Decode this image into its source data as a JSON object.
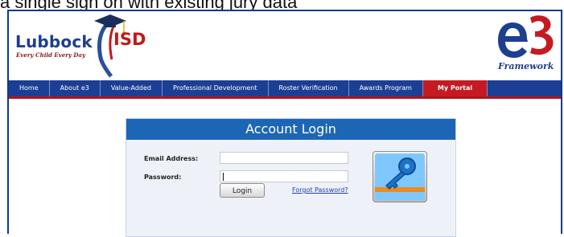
{
  "top_caption": "a single sign on with existing jury data",
  "logo": {
    "name": "Lubbock",
    "suffix": "ISD",
    "tagline": "Every Child Every Day"
  },
  "brand": {
    "framework": "Framework"
  },
  "nav": [
    {
      "label": "Home",
      "active": false
    },
    {
      "label": "About e3",
      "active": false
    },
    {
      "label": "Value-Added",
      "active": false
    },
    {
      "label": "Professional Development",
      "active": false
    },
    {
      "label": "Roster Verification",
      "active": false
    },
    {
      "label": "Awards Program",
      "active": false
    },
    {
      "label": "My Portal",
      "active": true
    }
  ],
  "login": {
    "title": "Account Login",
    "email_label": "Email Address:",
    "email_value": "",
    "password_label": "Password:",
    "password_value": "",
    "login_button": "Login",
    "forgot_link": "Forgot Password?"
  },
  "colors": {
    "nav_bg": "#1c3e94",
    "nav_active": "#c61a22",
    "accent_red": "#b3121b",
    "login_header": "#1d66b5"
  },
  "icons": {
    "key": "key-icon",
    "cap": "graduation-cap-icon"
  }
}
